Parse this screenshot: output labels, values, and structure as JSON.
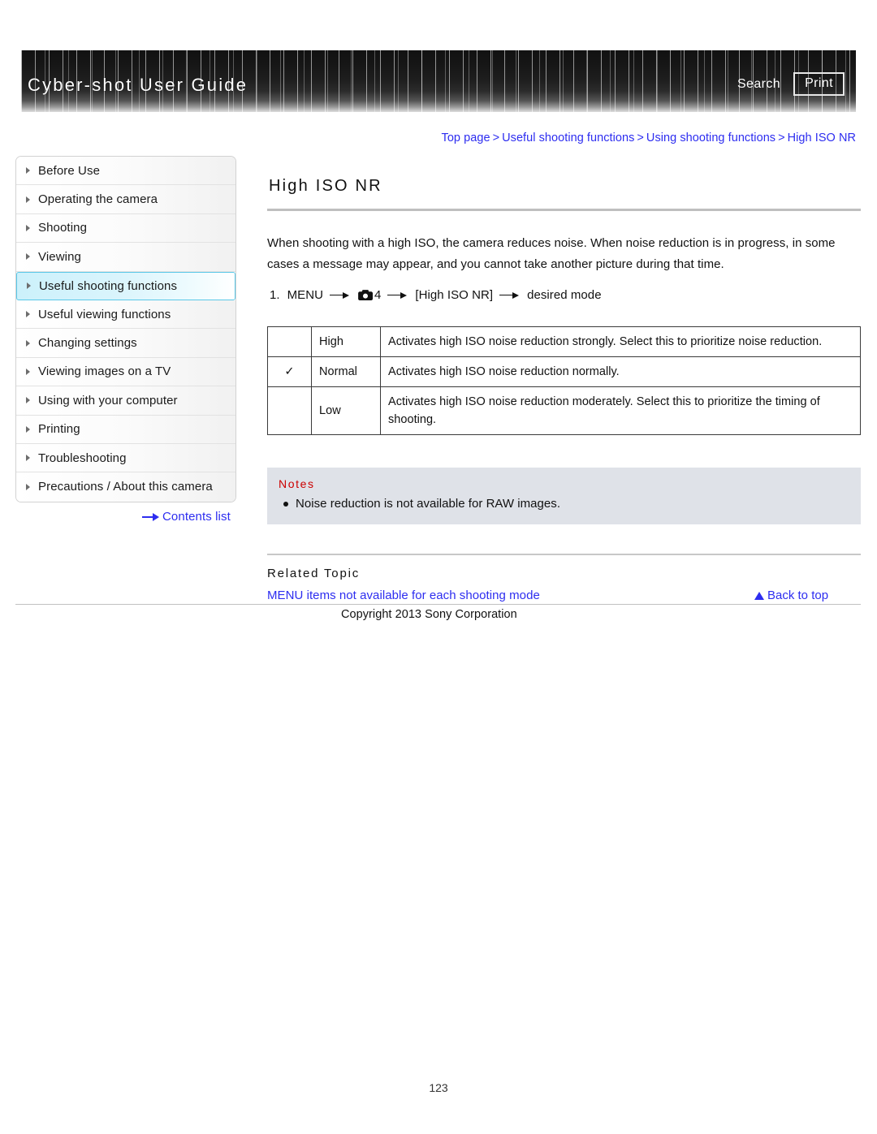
{
  "header": {
    "title": "Cyber-shot User Guide",
    "search_label": "Search",
    "print_label": "Print"
  },
  "breadcrumb": {
    "items": [
      {
        "label": "Top page"
      },
      {
        "label": "Useful shooting functions"
      },
      {
        "label": "Using shooting functions"
      },
      {
        "label": "High ISO NR"
      }
    ],
    "separator": ">"
  },
  "sidebar": {
    "items": [
      {
        "label": "Before Use",
        "selected": false
      },
      {
        "label": "Operating the camera",
        "selected": false
      },
      {
        "label": "Shooting",
        "selected": false
      },
      {
        "label": "Viewing",
        "selected": false
      },
      {
        "label": "Useful shooting functions",
        "selected": true
      },
      {
        "label": "Useful viewing functions",
        "selected": false
      },
      {
        "label": "Changing settings",
        "selected": false
      },
      {
        "label": "Viewing images on a TV",
        "selected": false
      },
      {
        "label": "Using with your computer",
        "selected": false
      },
      {
        "label": "Printing",
        "selected": false
      },
      {
        "label": "Troubleshooting",
        "selected": false
      },
      {
        "label": "Precautions / About this camera",
        "selected": false
      }
    ],
    "contents_link": "Contents list"
  },
  "main": {
    "title": "High ISO NR",
    "intro": "When shooting with a high ISO, the camera reduces noise. When noise reduction is in progress, in some cases a message may appear, and you cannot take another picture during that time.",
    "step": {
      "number": "1.",
      "menu_label": "MENU",
      "menu_page": "4",
      "item_label": "[High ISO NR]",
      "result_label": "desired mode"
    },
    "options_table": {
      "rows": [
        {
          "mark": "",
          "name": "High",
          "description": "Activates high ISO noise reduction strongly. Select this to prioritize noise reduction."
        },
        {
          "mark": "✓",
          "name": "Normal",
          "description": "Activates high ISO noise reduction normally."
        },
        {
          "mark": "",
          "name": "Low",
          "description": "Activates high ISO noise reduction moderately. Select this to prioritize the timing of shooting."
        }
      ]
    },
    "notes": {
      "title": "Notes",
      "items": [
        "Noise reduction is not available for RAW images."
      ]
    },
    "related_topic": {
      "title": "Related Topic",
      "links": [
        "MENU items not available for each shooting mode"
      ]
    },
    "back_to_top": "Back to top"
  },
  "footer": {
    "copyright": "Copyright 2013 Sony Corporation",
    "page_number": "123"
  },
  "colors": {
    "link": "#2d2df0",
    "notes_title": "#cc0000",
    "notes_bg": "#dfe2e8",
    "selected_nav": "#ccf1fb",
    "selected_nav_border": "#5ac8e8"
  }
}
